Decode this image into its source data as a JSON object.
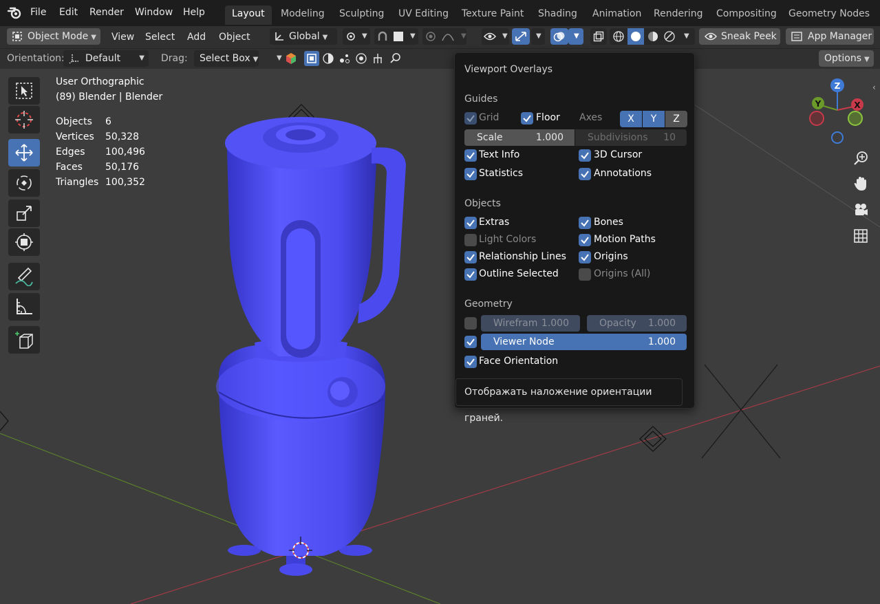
{
  "menu": {
    "items": [
      "File",
      "Edit",
      "Render",
      "Window",
      "Help"
    ]
  },
  "workspaces": {
    "tabs": [
      "Layout",
      "Modeling",
      "Sculpting",
      "UV Editing",
      "Texture Paint",
      "Shading",
      "Animation",
      "Rendering",
      "Compositing",
      "Geometry Nodes"
    ],
    "active": "Layout"
  },
  "header": {
    "mode": "Object Mode",
    "view": "View",
    "select": "Select",
    "add": "Add",
    "object": "Object",
    "transform_orientation": "Global",
    "sneak_peek": "Sneak Peek",
    "app_manager": "App Manager",
    "orientation_label": "Orientation:",
    "orientation_value": "Default",
    "drag_label": "Drag:",
    "drag_value": "Select Box",
    "options": "Options"
  },
  "viewport": {
    "view_name": "User Orthographic",
    "collection": "(89) Blender | Blender",
    "stats": {
      "objects_label": "Objects",
      "objects": "6",
      "vertices_label": "Vertices",
      "vertices": "50,328",
      "edges_label": "Edges",
      "edges": "100,496",
      "faces_label": "Faces",
      "faces": "50,176",
      "triangles_label": "Triangles",
      "triangles": "100,352"
    },
    "gizmo": {
      "z": "Z",
      "y": "Y",
      "x": "X"
    }
  },
  "overlays": {
    "title": "Viewport Overlays",
    "guides_header": "Guides",
    "grid": "Grid",
    "floor": "Floor",
    "axes": "Axes",
    "axis_x": "X",
    "axis_y": "Y",
    "axis_z": "Z",
    "scale_label": "Scale",
    "scale_value": "1.000",
    "subdivisions_label": "Subdivisions",
    "subdivisions_value": "10",
    "text_info": "Text Info",
    "cursor_3d": "3D Cursor",
    "statistics": "Statistics",
    "annotations": "Annotations",
    "objects_header": "Objects",
    "extras": "Extras",
    "bones": "Bones",
    "light_colors": "Light Colors",
    "motion_paths": "Motion Paths",
    "relationship_lines": "Relationship Lines",
    "origins": "Origins",
    "outline_selected": "Outline Selected",
    "origins_all": "Origins (All)",
    "geometry_header": "Geometry",
    "wireframe_label": "Wirefram",
    "wireframe_value": "1.000",
    "opacity_label": "Opacity",
    "opacity_value": "1.000",
    "viewer_node_label": "Viewer Node",
    "viewer_node_value": "1.000",
    "face_orientation": "Face Orientation"
  },
  "tooltip": "Отображать наложение ориентации граней.",
  "colors": {
    "accent": "#4772b3",
    "mesh": "#4d4dff",
    "background": "#3d3d3d",
    "x_axis": "#c83a49",
    "y_axis": "#6b9a2b"
  }
}
